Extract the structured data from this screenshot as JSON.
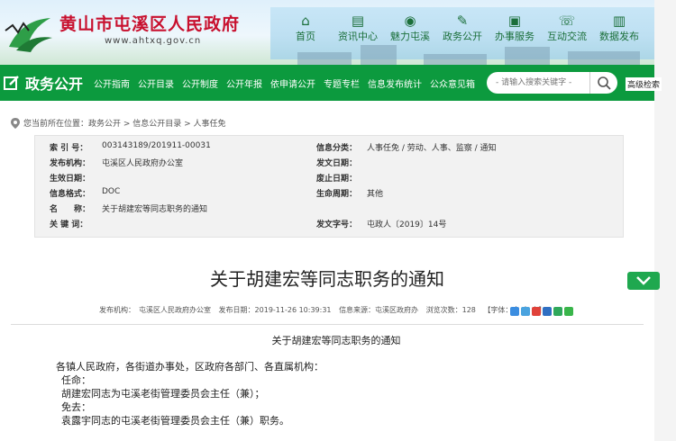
{
  "header": {
    "site_title": "黄山市屯溪区人民政府",
    "site_url": "www.ahtxq.gov.cn",
    "nav": [
      {
        "label": "首页",
        "icon": "home-icon",
        "glyph": "⌂"
      },
      {
        "label": "资讯中心",
        "icon": "news-icon",
        "glyph": "▤"
      },
      {
        "label": "魅力屯溪",
        "icon": "camera-icon",
        "glyph": "◉"
      },
      {
        "label": "政务公开",
        "icon": "edit-icon",
        "glyph": "✎"
      },
      {
        "label": "办事服务",
        "icon": "service-icon",
        "glyph": "▣"
      },
      {
        "label": "互动交流",
        "icon": "chat-icon",
        "glyph": "☏"
      },
      {
        "label": "数据发布",
        "icon": "chart-icon",
        "glyph": "▥"
      }
    ]
  },
  "section": {
    "title": "政务公开",
    "subnav": [
      "公开指南",
      "公开目录",
      "公开制度",
      "公开年报",
      "依申请公开",
      "专题专栏",
      "信息发布统计",
      "公众意见箱"
    ],
    "search_placeholder": "- 请输入搜索关键字 -",
    "advanced_search": "高级检索"
  },
  "breadcrumb": "您当前所在位置：政务公开 > 信息公开目录 > 人事任免",
  "info": {
    "rows": [
      {
        "l": "索 引 号：",
        "v": "003143189/201911-00031",
        "l2": "信息分类：",
        "v2": "人事任免 / 劳动、人事、监察 / 通知"
      },
      {
        "l": "发布机构：",
        "v": "屯溪区人民政府办公室",
        "l2": "发文日期：",
        "v2": ""
      },
      {
        "l": "生效日期：",
        "v": "",
        "l2": "废止日期：",
        "v2": ""
      },
      {
        "l": "信息格式：",
        "v": "DOC",
        "l2": "生命周期：",
        "v2": "其他"
      },
      {
        "l": "名　　称：",
        "v": "关于胡建宏等同志职务的通知",
        "l2": "",
        "v2": ""
      },
      {
        "l": "关 键 词：",
        "v": "",
        "l2": "发文字号：",
        "v2": "屯政人〔2019〕14号"
      }
    ]
  },
  "article": {
    "title": "关于胡建宏等同志职务的通知",
    "meta": {
      "publisher": "发布机构：　屯溪区人民政府办公室",
      "date": "发布日期：2019-11-26 10:39:31",
      "source": "信息来源：屯溪区政府办",
      "views": "浏览次数：128",
      "font_size": "【字体：大 中 小】"
    },
    "subtitle": "关于胡建宏等同志职务的通知",
    "body": [
      "各镇人民政府，各街道办事处，区政府各部门、各直属机构：",
      "任命：",
      "胡建宏同志为屯溪老街管理委员会主任（兼）；",
      "免去：",
      "袁露宇同志的屯溪老街管理委员会主任（兼）职务。"
    ]
  },
  "share_icons": [
    {
      "name": "share-qzone-icon",
      "color": "#3b8de0"
    },
    {
      "name": "share-tencent-icon",
      "color": "#4aa3df"
    },
    {
      "name": "share-weibo-icon",
      "color": "#e0423a"
    },
    {
      "name": "share-renren-icon",
      "color": "#2f6fc2"
    },
    {
      "name": "share-douban-icon",
      "color": "#2fa85b"
    },
    {
      "name": "share-wechat-icon",
      "color": "#39b54a"
    }
  ],
  "colors": {
    "brand_red": "#c8102e",
    "brand_green": "#0c9a3e"
  }
}
